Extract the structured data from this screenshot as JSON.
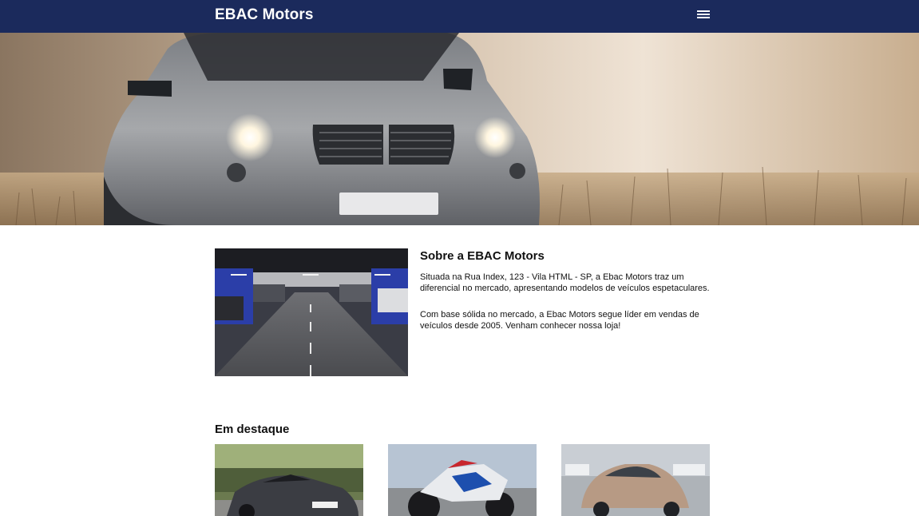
{
  "header": {
    "logo": "EBAC Motors",
    "menu_icon": "hamburger-menu-icon"
  },
  "hero": {
    "image": "hero-suv-car-image"
  },
  "about": {
    "title": "Sobre a EBAC Motors",
    "paragraph1": "Situada na Rua Index, 123 - Vila HTML - SP, a Ebac Motors traz um diferencial no mercado, apresentando modelos de veículos espetaculares.",
    "paragraph2": "Com base sólida no mercado, a Ebac Motors segue líder em vendas de veículos desde 2005. Venham conhecer nossa loja!",
    "image": "parking-garage-image"
  },
  "featured": {
    "title": "Em destaque",
    "items": [
      {
        "image": "gray-roadster-image"
      },
      {
        "image": "motorcycle-image"
      },
      {
        "image": "beetle-car-image"
      }
    ]
  },
  "colors": {
    "header_bg": "#1b2a5c",
    "text": "#111111"
  }
}
